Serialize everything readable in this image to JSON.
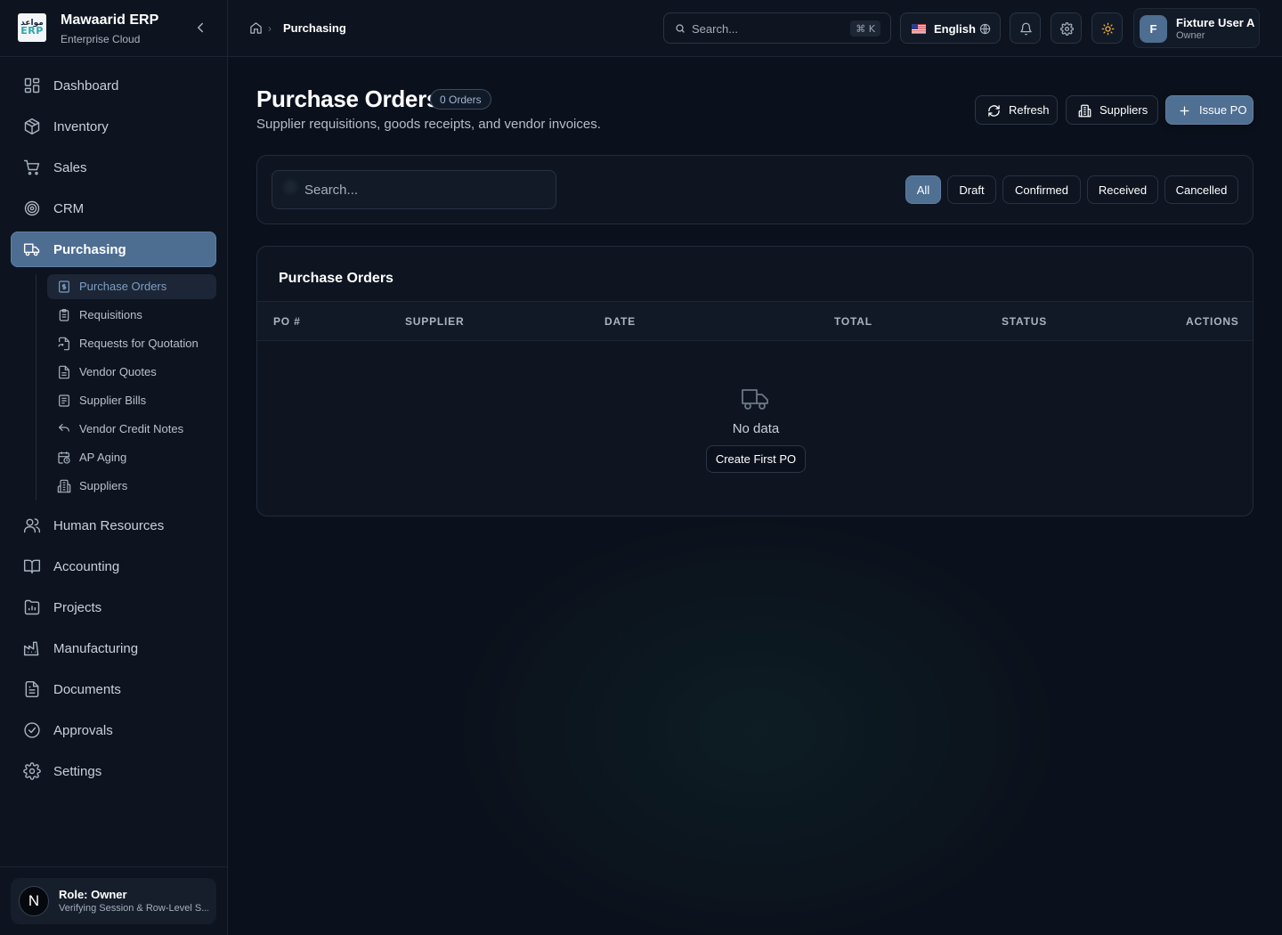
{
  "brand": {
    "logo_ar": "مواعد",
    "logo_en": "ERP",
    "name": "Mawaarid ERP",
    "subtitle": "Enterprise Cloud"
  },
  "sidebar": {
    "items": [
      {
        "label": "Dashboard",
        "icon": "dashboard-icon"
      },
      {
        "label": "Inventory",
        "icon": "box-icon"
      },
      {
        "label": "Sales",
        "icon": "cart-icon"
      },
      {
        "label": "CRM",
        "icon": "target-icon"
      },
      {
        "label": "Purchasing",
        "icon": "truck-icon",
        "active": true
      },
      {
        "label": "Human Resources",
        "icon": "users-icon"
      },
      {
        "label": "Accounting",
        "icon": "book-icon"
      },
      {
        "label": "Projects",
        "icon": "folder-chart-icon"
      },
      {
        "label": "Manufacturing",
        "icon": "factory-icon"
      },
      {
        "label": "Documents",
        "icon": "file-icon"
      },
      {
        "label": "Approvals",
        "icon": "check-circle-icon"
      },
      {
        "label": "Settings",
        "icon": "gear-icon"
      }
    ],
    "purchasing_sub": [
      {
        "label": "Purchase Orders",
        "icon": "receipt-icon",
        "active": true
      },
      {
        "label": "Requisitions",
        "icon": "clipboard-icon"
      },
      {
        "label": "Requests for Quotation",
        "icon": "file-refresh-icon"
      },
      {
        "label": "Vendor Quotes",
        "icon": "file-text-icon"
      },
      {
        "label": "Supplier Bills",
        "icon": "bill-icon"
      },
      {
        "label": "Vendor Credit Notes",
        "icon": "undo-icon"
      },
      {
        "label": "AP Aging",
        "icon": "calendar-clock-icon"
      },
      {
        "label": "Suppliers",
        "icon": "building-icon"
      }
    ],
    "role": {
      "avatar": "N",
      "title": "Role: Owner",
      "subtitle": "Verifying Session & Row-Level S..."
    }
  },
  "topbar": {
    "breadcrumb": {
      "separator": "›",
      "current": "Purchasing"
    },
    "search": {
      "placeholder": "Search...",
      "shortcut": "⌘ K"
    },
    "language": {
      "label": "English"
    },
    "user": {
      "initial": "F",
      "name": "Fixture User A",
      "role": "Owner"
    }
  },
  "page": {
    "title": "Purchase Orders",
    "count_badge": "0 Orders",
    "subtitle": "Supplier requisitions, goods receipts, and vendor invoices.",
    "actions": {
      "refresh": "Refresh",
      "suppliers": "Suppliers",
      "issue": "Issue PO"
    }
  },
  "filters": {
    "search_placeholder": "Search...",
    "chips": [
      "All",
      "Draft",
      "Confirmed",
      "Received",
      "Cancelled"
    ],
    "active": "All"
  },
  "table": {
    "title": "Purchase Orders",
    "columns": [
      "PO #",
      "SUPPLIER",
      "DATE",
      "TOTAL",
      "STATUS",
      "ACTIONS"
    ],
    "rows": [],
    "empty_text": "No data",
    "empty_action": "Create First PO"
  },
  "colors": {
    "accent": "#4f6f93",
    "background": "#0b111c",
    "panel": "#0e1521",
    "warning_icon": "#f5b342"
  }
}
